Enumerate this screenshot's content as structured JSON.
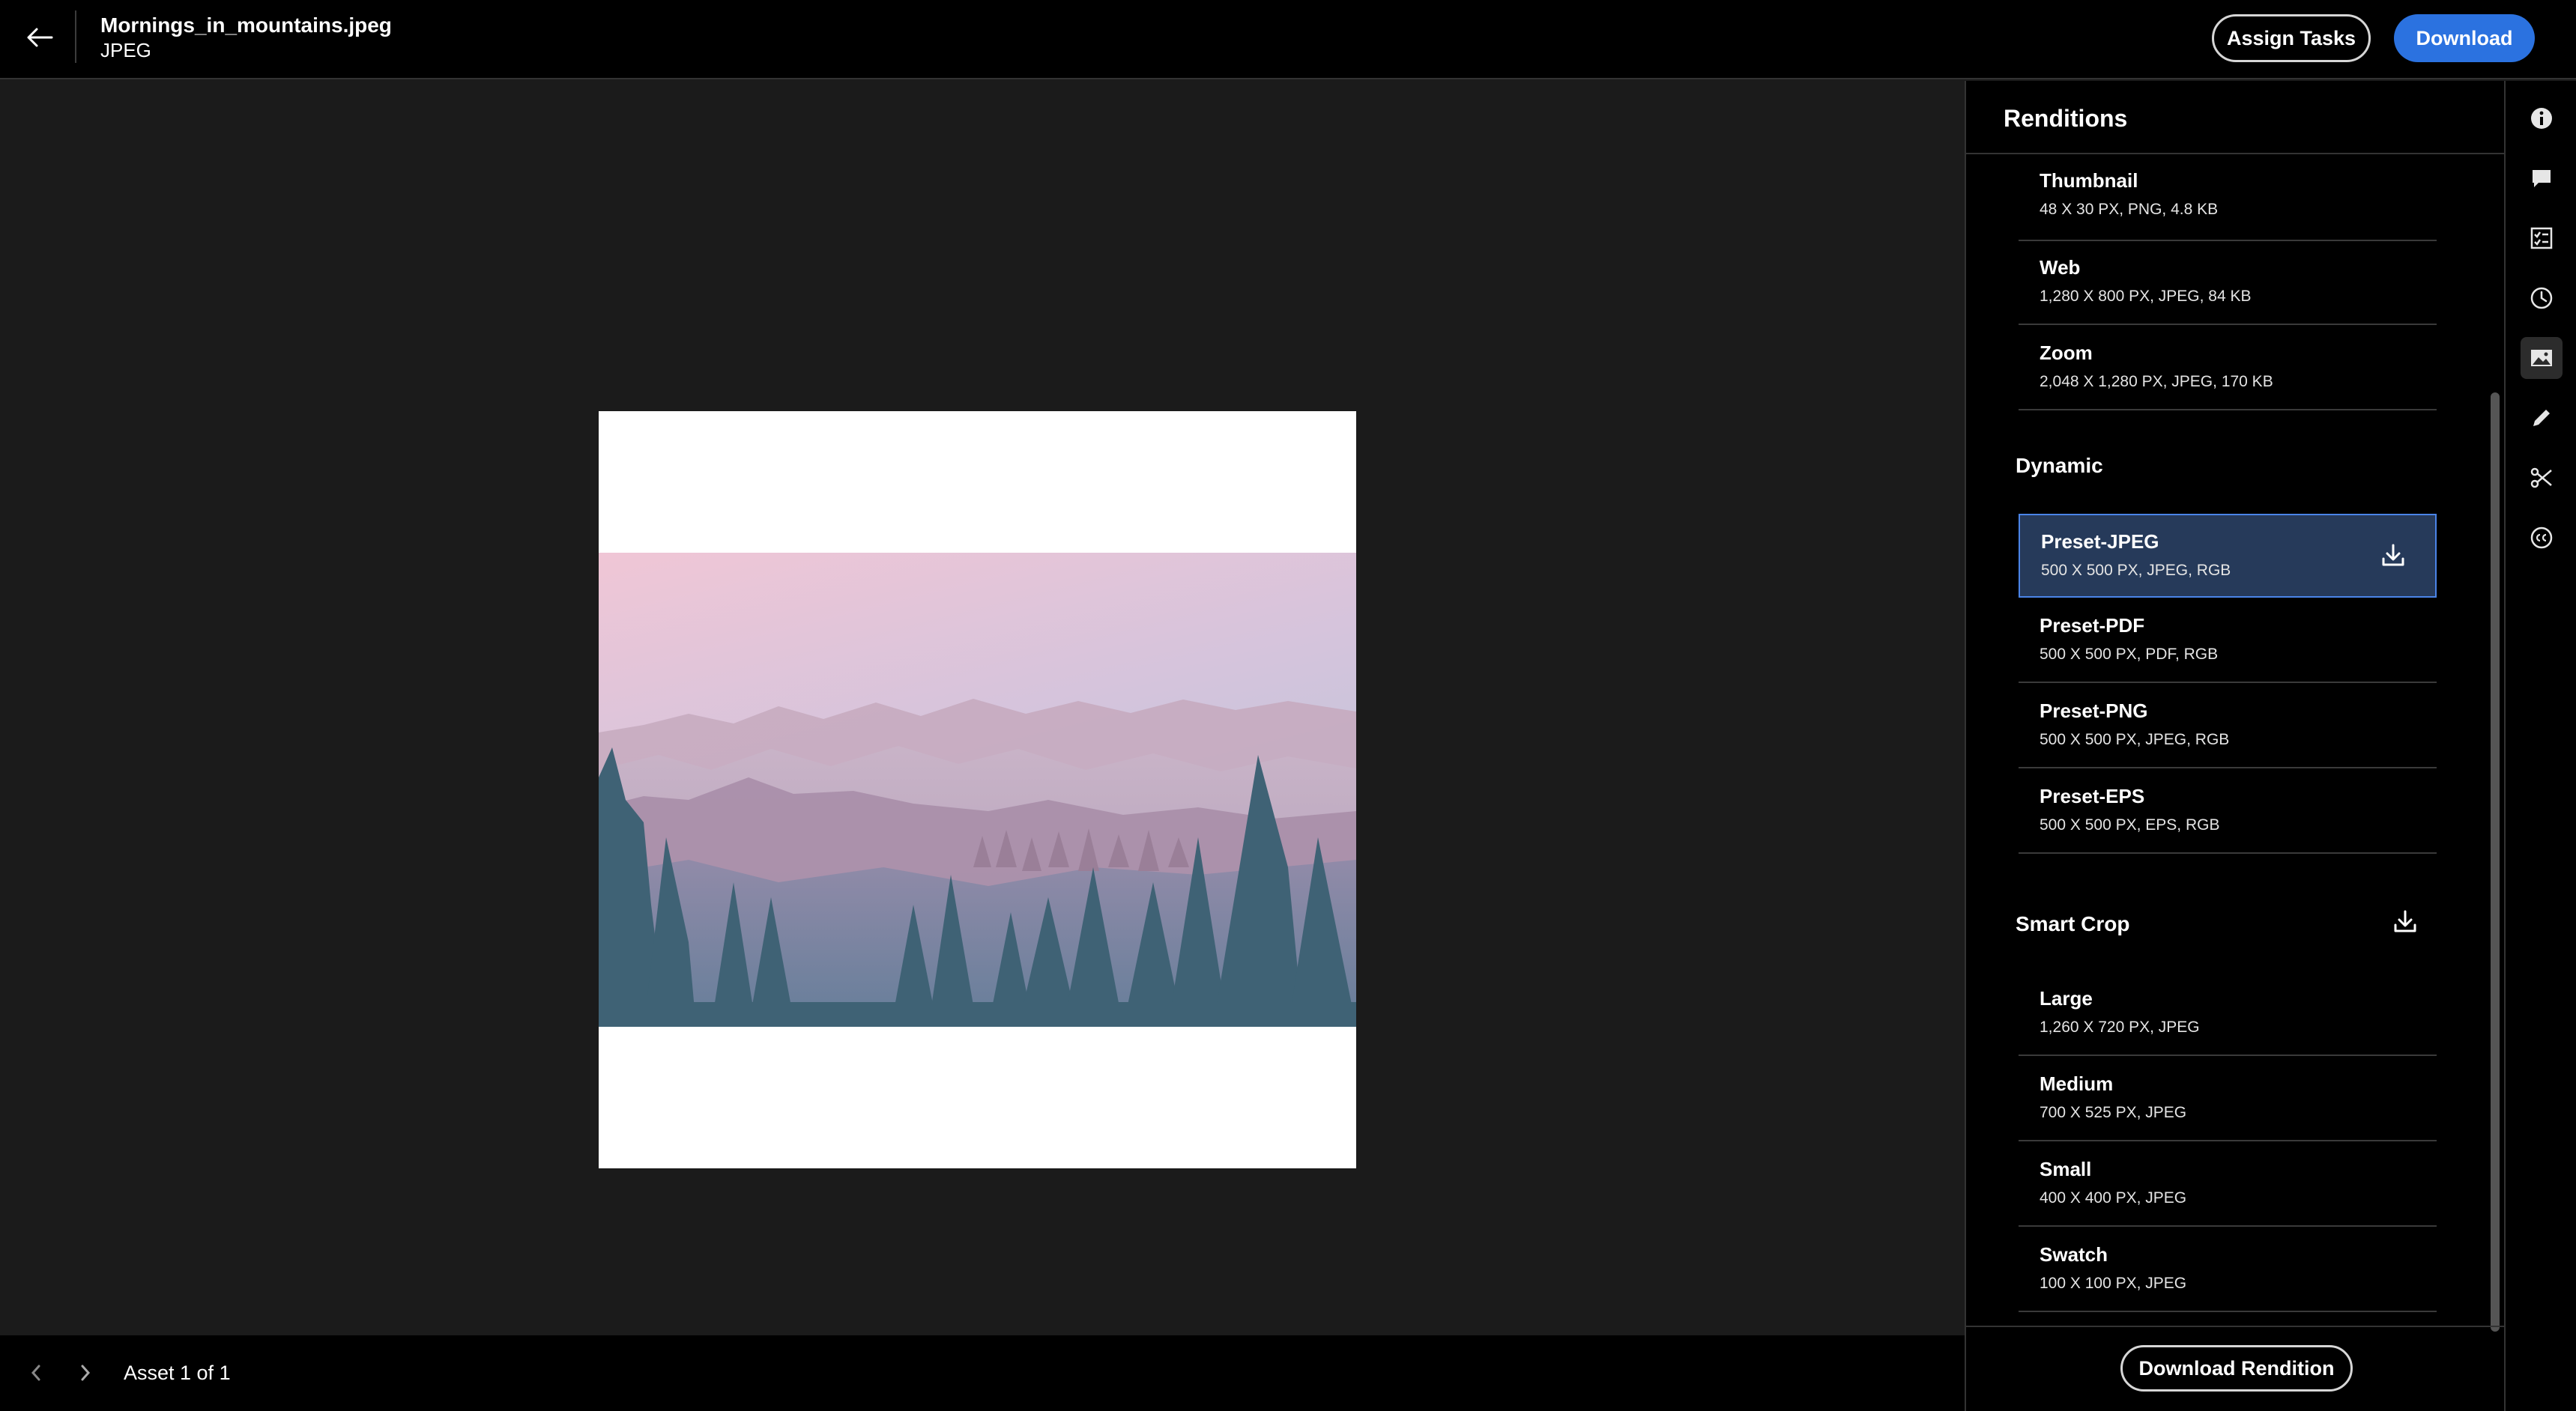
{
  "header": {
    "file_name": "Mornings_in_mountains.jpeg",
    "file_type": "JPEG",
    "assign_tasks_label": "Assign Tasks",
    "download_label": "Download"
  },
  "footer": {
    "asset_count": "Asset 1 of 1"
  },
  "renditions_panel": {
    "title": "Renditions",
    "static_items": [
      {
        "name": "Thumbnail",
        "meta": "48 X 30 PX, PNG, 4.8 KB"
      },
      {
        "name": "Web",
        "meta": "1,280 X 800 PX, JPEG, 84 KB"
      },
      {
        "name": "Zoom",
        "meta": "2,048 X 1,280 PX, JPEG, 170 KB"
      }
    ],
    "dynamic_label": "Dynamic",
    "dynamic_items": [
      {
        "name": "Preset-JPEG",
        "meta": "500 X 500 PX, JPEG, RGB",
        "selected": true
      },
      {
        "name": "Preset-PDF",
        "meta": "500 X 500 PX, PDF, RGB"
      },
      {
        "name": "Preset-PNG",
        "meta": "500 X 500 PX, JPEG, RGB"
      },
      {
        "name": "Preset-EPS",
        "meta": "500 X 500 PX, EPS, RGB"
      }
    ],
    "smart_crop_label": "Smart Crop",
    "smart_crop_items": [
      {
        "name": "Large",
        "meta": "1,260 X 720 PX, JPEG"
      },
      {
        "name": "Medium",
        "meta": "700 X 525 PX, JPEG"
      },
      {
        "name": "Small",
        "meta": "400 X 400 PX, JPEG"
      },
      {
        "name": "Swatch",
        "meta": "100 X 100 PX, JPEG"
      }
    ],
    "download_rendition_label": "Download Rendition"
  },
  "rail": {
    "icons": [
      "info-icon",
      "comment-icon",
      "tasks-icon",
      "history-icon",
      "renditions-icon",
      "edit-icon",
      "cut-icon",
      "cc-icon"
    ],
    "active": "renditions-icon"
  },
  "colors": {
    "accent": "#2b72e0",
    "selected_bg": "#263a5a",
    "selected_border": "#4a84e8"
  }
}
